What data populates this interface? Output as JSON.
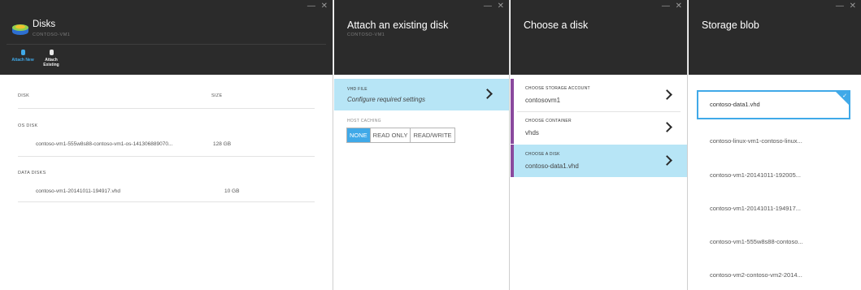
{
  "window_controls": "— ✕",
  "disks_blade": {
    "title": "Disks",
    "subtitle": "CONTOSO-VM1",
    "commands": [
      {
        "label": "Attach New",
        "icon": "disk-add-icon"
      },
      {
        "label": "Attach Existing",
        "icon": "disk-icon"
      }
    ],
    "columns": {
      "disk": "DISK",
      "size": "SIZE"
    },
    "os_section": "OS DISK",
    "os_disk": {
      "name": "contoso-vm1-555w8s88-contoso-vm1-os-141306889070...",
      "size": "128 GB"
    },
    "data_section": "DATA DISKS",
    "data_disks": [
      {
        "name": "contoso-vm1-20141011-194917.vhd",
        "size": "10 GB"
      }
    ]
  },
  "attach_blade": {
    "title": "Attach an existing disk",
    "subtitle": "CONTOSO-VM1",
    "vhd_label": "VHD FILE",
    "vhd_value": "Configure required settings",
    "host_caching_label": "HOST CACHING",
    "caching_options": [
      "NONE",
      "READ ONLY",
      "READ/WRITE"
    ],
    "caching_selected": "NONE"
  },
  "choose_disk_blade": {
    "title": "Choose a disk",
    "rows": [
      {
        "label": "CHOOSE STORAGE ACCOUNT",
        "value": "contosovm1"
      },
      {
        "label": "CHOOSE CONTAINER",
        "value": "vhds"
      },
      {
        "label": "CHOOSE A DISK",
        "value": "contoso-data1.vhd"
      }
    ]
  },
  "blob_blade": {
    "title": "Storage blob",
    "selected": "contoso-data1.vhd",
    "blobs": [
      "contoso-data1.vhd",
      "contoso-linux-vm1-contoso-linux...",
      "contoso-vm1-20141011-192005...",
      "contoso-vm1-20141011-194917...",
      "contoso-vm1-555w8s88-contoso...",
      "contoso-vm2-contoso-vm2-2014..."
    ]
  },
  "colors": {
    "header_bg": "#2b2b2b",
    "accent": "#40a9e8",
    "selected_row": "#b7e5f6",
    "row_marker": "#8a4a9e"
  }
}
